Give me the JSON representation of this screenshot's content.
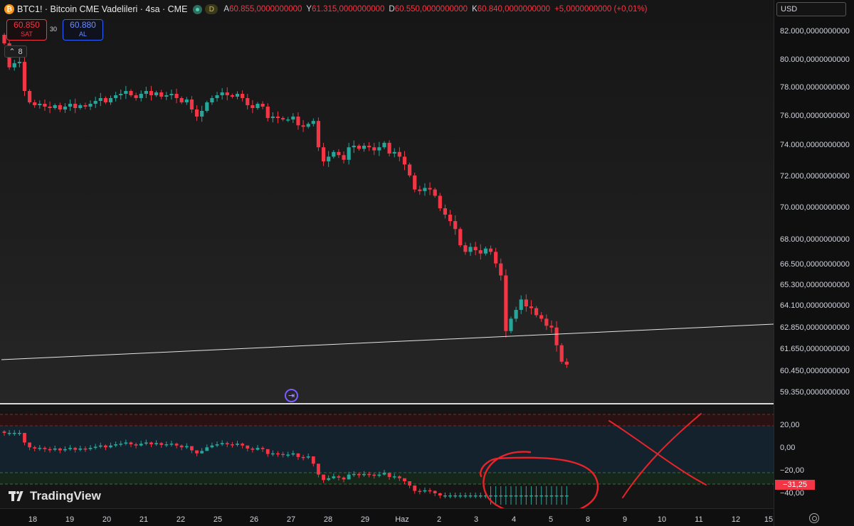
{
  "legend": {
    "coin_glyph": "₿",
    "symbol": "BTC1! · Bitcoin CME Vadelileri · 4sa · CME",
    "d_badge": "D",
    "ohlc": [
      {
        "label": "A",
        "value": "60.855,0000000000"
      },
      {
        "label": "Y",
        "value": "61.315,0000000000"
      },
      {
        "label": "D",
        "value": "60.550,0000000000"
      },
      {
        "label": "K",
        "value": "60.840,0000000000"
      }
    ],
    "change": "+5,0000000000 (+0,01%)"
  },
  "trade": {
    "sell_price": "60.850",
    "sell_label": "SAT",
    "spread": "30",
    "buy_price": "60.880",
    "buy_label": "AL"
  },
  "collapse": {
    "count": "8"
  },
  "currency": "USD",
  "price_scale": [
    {
      "label": "82.000,0000000000",
      "value": 82000
    },
    {
      "label": "80.000,0000000000",
      "value": 80000
    },
    {
      "label": "78.000,0000000000",
      "value": 78000
    },
    {
      "label": "76.000,0000000000",
      "value": 76000
    },
    {
      "label": "74.000,0000000000",
      "value": 74000
    },
    {
      "label": "72.000,0000000000",
      "value": 72000
    },
    {
      "label": "70.000,0000000000",
      "value": 70000
    },
    {
      "label": "68.000,0000000000",
      "value": 68000
    },
    {
      "label": "66.500,0000000000",
      "value": 66500
    },
    {
      "label": "65.300,0000000000",
      "value": 65300
    },
    {
      "label": "64.100,0000000000",
      "value": 64100
    },
    {
      "label": "62.850,0000000000",
      "value": 62850
    },
    {
      "label": "61.650,0000000000",
      "value": 61650
    },
    {
      "label": "60.450,0000000000",
      "value": 60450
    },
    {
      "label": "59.350,0000000000",
      "value": 59350
    }
  ],
  "indicator_scale": [
    {
      "label": "20,00",
      "value": 20
    },
    {
      "label": "0,00",
      "value": 0
    },
    {
      "label": "−20,00",
      "value": -20
    },
    {
      "label": "−40,00",
      "value": -40
    }
  ],
  "indicator_last": "−31,25",
  "time_axis": [
    "18",
    "19",
    "20",
    "21",
    "22",
    "25",
    "26",
    "27",
    "28",
    "29",
    "Haz",
    "2",
    "3",
    "4",
    "5",
    "8",
    "9",
    "10",
    "11",
    "12",
    "15"
  ],
  "brand": "TradingView",
  "colors": {
    "up": "#26a69a",
    "down": "#f23645",
    "annotation": "#e8232a",
    "goto": "#7b5cff"
  },
  "chart_data": {
    "type": "candlestick",
    "price_closes": [
      81200,
      79500,
      79800,
      79900,
      77800,
      77000,
      76800,
      76900,
      76700,
      76600,
      76800,
      76500,
      76700,
      76900,
      76600,
      76800,
      76700,
      76900,
      77100,
      77300,
      77000,
      77300,
      77500,
      77600,
      77800,
      77500,
      77300,
      77600,
      77800,
      77500,
      77700,
      77400,
      77500,
      77600,
      77300,
      77000,
      77200,
      76500,
      76000,
      76400,
      77000,
      77300,
      77500,
      77700,
      77500,
      77400,
      77600,
      77300,
      76800,
      76600,
      76900,
      76700,
      75900,
      76000,
      75900,
      75800,
      75800,
      76000,
      75400,
      75300,
      75500,
      75700,
      73900,
      73000,
      73300,
      73600,
      73400,
      73100,
      73900,
      74000,
      73800,
      74000,
      73900,
      73700,
      73900,
      74200,
      73500,
      73600,
      73300,
      72800,
      72100,
      71200,
      71100,
      71300,
      71200,
      70800,
      70000,
      69600,
      69200,
      68700,
      67700,
      67300,
      67600,
      67400,
      67200,
      67500,
      67300,
      66600,
      65900,
      62700,
      63400,
      63900,
      64500,
      64100,
      64000,
      63600,
      63400,
      63000,
      62900,
      61900,
      61000,
      60840
    ],
    "indicator": {
      "last": -31.25,
      "levels": [
        20,
        0,
        -20,
        -40
      ]
    }
  }
}
